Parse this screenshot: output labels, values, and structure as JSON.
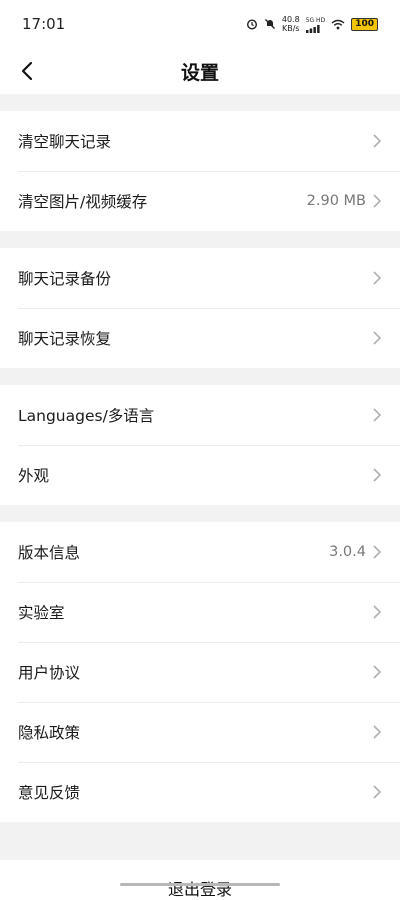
{
  "status_bar": {
    "time": "17:01",
    "speed_value": "40.8",
    "speed_unit": "KB/s",
    "network": "5G HD",
    "battery": "100",
    "icons": [
      "alarm-icon",
      "mute-icon",
      "signal-icon",
      "wifi-icon",
      "battery-icon"
    ]
  },
  "header": {
    "title": "设置",
    "back_icon": "chevron-left-icon"
  },
  "groups": [
    {
      "items": [
        {
          "label": "清空聊天记录",
          "value": ""
        },
        {
          "label": "清空图片/视频缓存",
          "value": "2.90 MB"
        }
      ]
    },
    {
      "items": [
        {
          "label": "聊天记录备份",
          "value": ""
        },
        {
          "label": "聊天记录恢复",
          "value": ""
        }
      ]
    },
    {
      "items": [
        {
          "label": "Languages/多语言",
          "value": ""
        },
        {
          "label": "外观",
          "value": ""
        }
      ]
    },
    {
      "items": [
        {
          "label": "版本信息",
          "value": "3.0.4"
        },
        {
          "label": "实验室",
          "value": ""
        },
        {
          "label": "用户协议",
          "value": ""
        },
        {
          "label": "隐私政策",
          "value": ""
        },
        {
          "label": "意见反馈",
          "value": ""
        }
      ]
    }
  ],
  "logout": {
    "label": "退出登录"
  },
  "colors": {
    "background": "#f2f2f2",
    "card": "#ffffff",
    "battery": "#f5c400",
    "chevron": "#b0b0b0"
  }
}
